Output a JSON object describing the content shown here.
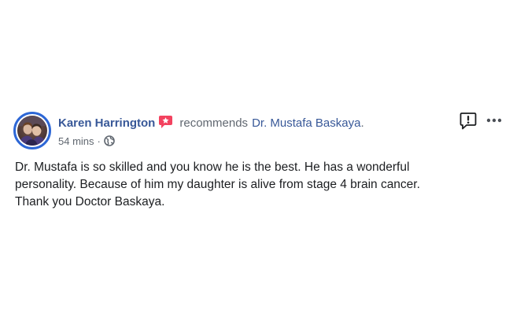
{
  "post": {
    "author": "Karen Harrington",
    "recommend_text": "recommends",
    "target": "Dr. Mustafa Baskaya",
    "target_suffix": ".",
    "timestamp": "54 mins",
    "separator": "·",
    "privacy_icon": "globe-icon",
    "badge_icon": "star-badge-icon",
    "report_icon": "report-exclamation-icon",
    "more_icon": "more-options-icon",
    "body_lines": [
      "Dr. Mustafa is so skilled and you know he is the best. He has a wonderful",
      "personality. Because of him my daughter is alive from stage 4 brain cancer.",
      "Thank you Doctor Baskaya."
    ]
  },
  "colors": {
    "link_blue": "#385898",
    "avatar_ring": "#2d67d6",
    "badge_pink": "#f3425f",
    "meta_gray": "#606770",
    "text": "#1c1e21"
  }
}
